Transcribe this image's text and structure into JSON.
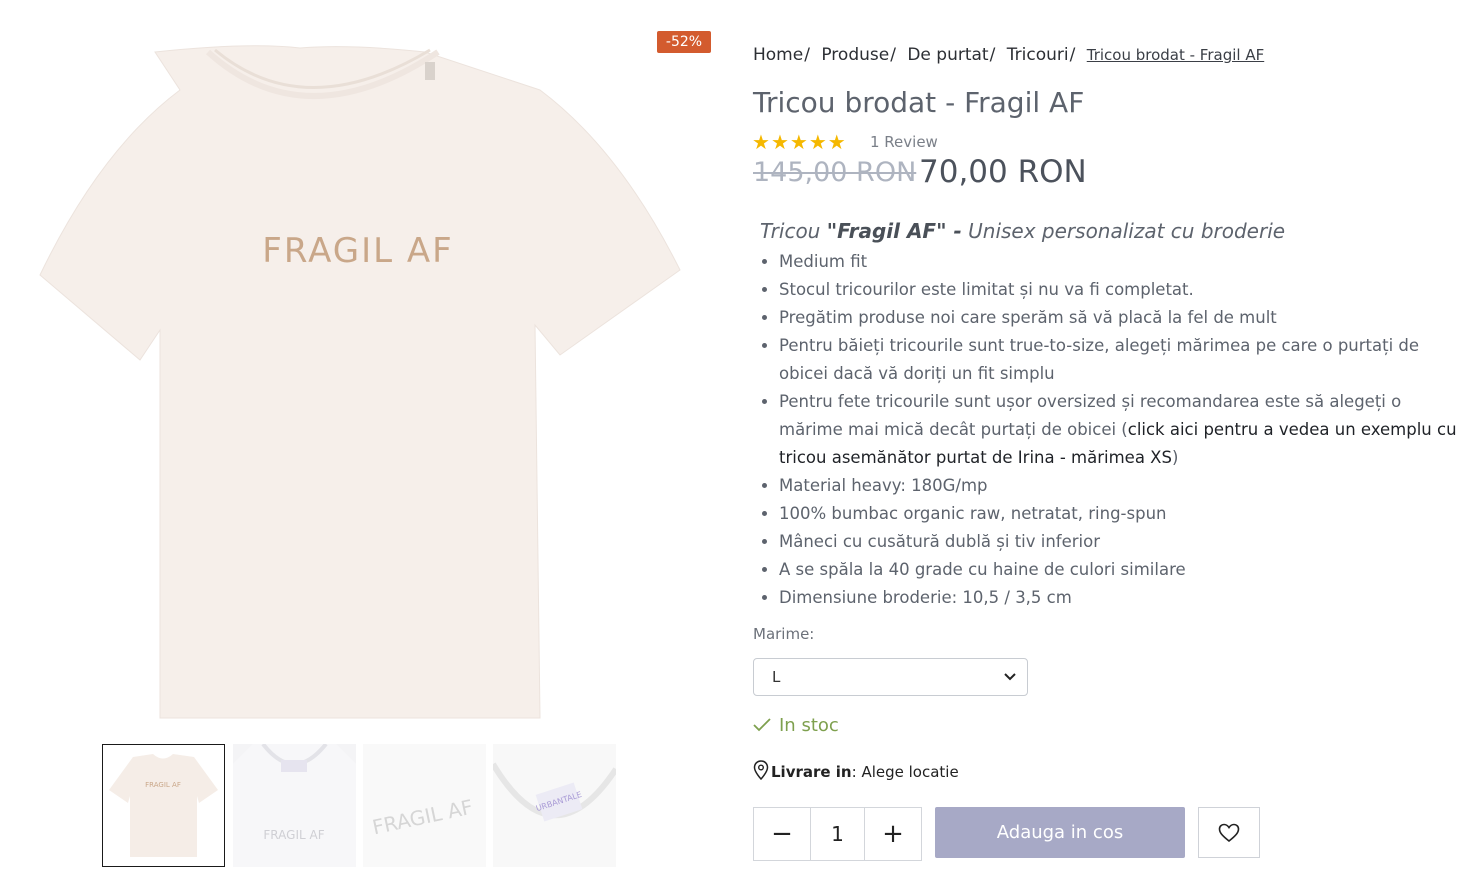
{
  "gallery": {
    "discount_badge": "-52%",
    "main_image_print": "FRAGIL AF",
    "thumb_prints": [
      "FRAGIL AF",
      "FRAGIL AF",
      "FRAGIL AF",
      "URBANTALE"
    ]
  },
  "breadcrumb": {
    "items": [
      "Home",
      "Produse",
      "De purtat",
      "Tricouri"
    ],
    "separator": "/",
    "current": "Tricou brodat - Fragil AF"
  },
  "product": {
    "title": "Tricou brodat - Fragil AF",
    "rating": 5,
    "review_count": "1 Review",
    "price_old": "145,00 RON",
    "price_new": "70,00 RON"
  },
  "description": {
    "heading_pre": "Tricou ",
    "heading_bold": "\"Fragil AF\" -",
    "heading_post": " Unisex personalizat cu broderie",
    "bullets": [
      "Medium fit",
      "Stocul tricourilor este limitat și nu va fi completat.",
      "Pregătim produse noi care sperăm să vă placă la fel de mult",
      "Pentru băieți tricourile sunt true-to-size, alegeți mărimea pe care o purtați de obicei dacă vă doriți un fit simplu",
      "Material heavy: 180G/mp",
      "100% bumbac organic raw, netratat, ring-spun",
      "Mâneci cu cusătură dublă și tiv inferior",
      "A se spăla la 40 grade cu haine de culori similare",
      "Dimensiune broderie: 10,5 / 3,5 cm"
    ],
    "fete_pre": "Pentru fete tricourile sunt ușor oversized și recomandarea este să alegeți o mărime mai mică decât purtați de obicei (",
    "fete_link": "click aici pentru a vedea un exemplu cu tricou asemănător purtat de Irina - mărimea XS",
    "fete_post": ")"
  },
  "options": {
    "size_label": "Marime:",
    "size_selected": "L"
  },
  "stock": {
    "label": "In stoc",
    "color": "#7ea04e"
  },
  "delivery": {
    "label_bold": "Livrare in",
    "colon": ":",
    "value": " Alege locatie"
  },
  "cart": {
    "quantity": "1",
    "minus": "−",
    "plus": "+",
    "add_label": "Adauga in cos",
    "button_color": "#a7a9c6"
  },
  "icons": [
    "star-icon",
    "check-icon",
    "location-pin-icon",
    "chevron-down-icon",
    "heart-icon"
  ]
}
